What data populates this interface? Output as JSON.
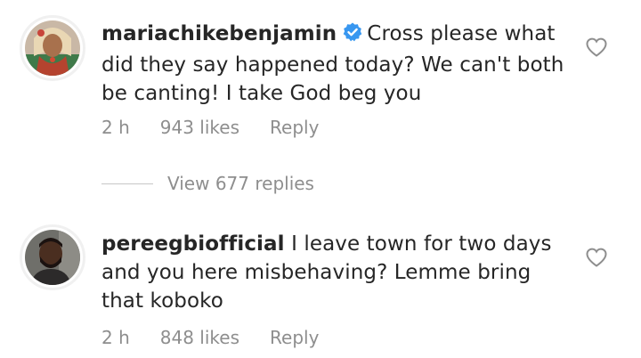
{
  "comments": [
    {
      "username": "mariachikebenjamin",
      "verified": true,
      "text_lines": [
        "Cross please what",
        "did they say happened today? We can't both",
        "be canting! I take God beg you"
      ],
      "time": "2 h",
      "likes": "943 likes",
      "reply_label": "Reply",
      "avatar_icon": "avatar-woman-icon"
    },
    {
      "username": "pereegbiofficial",
      "verified": false,
      "text_lines": [
        "I leave town for two days",
        "and you here misbehaving? Lemme bring",
        "that koboko"
      ],
      "time": "2 h",
      "likes": "848 likes",
      "reply_label": "Reply",
      "avatar_icon": "avatar-man-icon"
    }
  ],
  "view_replies_label": "View 677 replies",
  "colors": {
    "text": "#262626",
    "secondary": "#8e8e8e",
    "verified_blue": "#3897f0",
    "divider": "#c7c7c7"
  }
}
